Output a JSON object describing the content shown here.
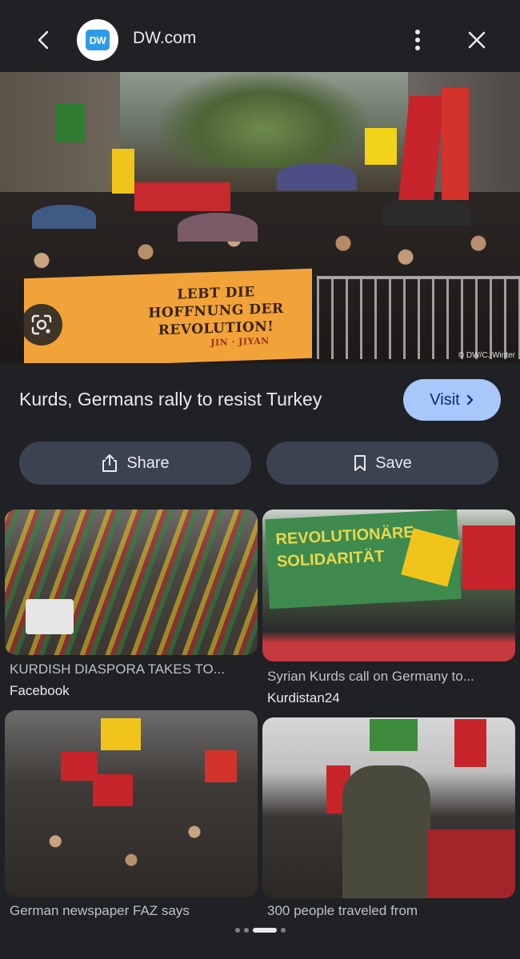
{
  "header": {
    "site_name": "DW.com",
    "logo_text": "DW",
    "back_icon": "arrow-back-icon",
    "more_icon": "more-vert-icon",
    "close_icon": "close-icon"
  },
  "hero": {
    "banner_lines": [
      "LEBT DIE",
      "HOFFNUNG DER",
      "REVOLUTION!"
    ],
    "banner_footer": "JIN · JIYAN",
    "credit": "© DW/C. Winter",
    "lens_icon": "google-lens-icon"
  },
  "result": {
    "title": "Kurds, Germans rally to resist Turkey",
    "visit_label": "Visit"
  },
  "actions": {
    "share_label": "Share",
    "save_label": "Save"
  },
  "related": [
    {
      "caption": "KURDISH DIASPORA TAKES TO...",
      "source": "Facebook"
    },
    {
      "caption": "Syrian Kurds call on Germany to...",
      "source": "Kurdistan24",
      "sign_text": [
        "REVOLUTIONÄRE",
        "SOLIDARITÄT"
      ]
    },
    {
      "caption": "German newspaper FAZ says",
      "source": ""
    },
    {
      "caption": "300 people traveled from",
      "source": ""
    }
  ],
  "pager": {
    "count": 4,
    "active": 2
  },
  "colors": {
    "background": "#202124",
    "visit_button": "#a8c7fa",
    "pill_button": "#3c4350",
    "text": "#e8eaed"
  }
}
